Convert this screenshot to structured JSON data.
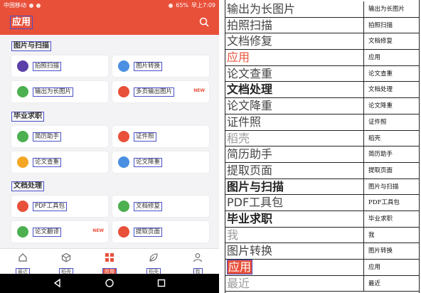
{
  "status_bar": {
    "carrier": "中国移动",
    "battery": "65%",
    "time": "早上7:09"
  },
  "app_bar": {
    "title": "应用"
  },
  "sections": [
    {
      "title": "图片与扫描",
      "items": [
        {
          "label": "拍照扫描",
          "icon_color": "#5b3fa8",
          "badge": ""
        },
        {
          "label": "图片转换",
          "icon_color": "#4a90e2",
          "badge": ""
        },
        {
          "label": "输出为长图片",
          "icon_color": "#4caf50",
          "badge": ""
        },
        {
          "label": "多页输出图片",
          "icon_color": "#e8503a",
          "badge": "NEW"
        }
      ]
    },
    {
      "title": "毕业求职",
      "items": [
        {
          "label": "简历助手",
          "icon_color": "#4caf50",
          "badge": ""
        },
        {
          "label": "证件照",
          "icon_color": "#e8503a",
          "badge": ""
        },
        {
          "label": "论文查重",
          "icon_color": "#f5a623",
          "badge": ""
        },
        {
          "label": "论文降重",
          "icon_color": "#4a90e2",
          "badge": ""
        }
      ]
    },
    {
      "title": "文档处理",
      "items": [
        {
          "label": "PDF工具包",
          "icon_color": "#e8503a",
          "badge": ""
        },
        {
          "label": "文档修复",
          "icon_color": "#4caf50",
          "badge": ""
        },
        {
          "label": "论文翻译",
          "icon_color": "#4caf50",
          "badge": "NEW"
        },
        {
          "label": "提取页面",
          "icon_color": "#e8503a",
          "badge": ""
        }
      ]
    }
  ],
  "tabs": [
    {
      "label": "最近",
      "icon": "home-icon"
    },
    {
      "label": "稻壳",
      "icon": "cube-icon"
    },
    {
      "label": "应用",
      "icon": "apps-grid-icon",
      "active": true
    },
    {
      "label": "稻壳",
      "icon": "leaf-icon"
    },
    {
      "label": "我",
      "icon": "person-icon"
    }
  ],
  "glossary": [
    {
      "zh": "输出为长图片",
      "en": "输出为长图片",
      "style": ""
    },
    {
      "zh": "拍照扫描",
      "en": "拍照扫描",
      "style": ""
    },
    {
      "zh": "文档修复",
      "en": "文档修复",
      "style": ""
    },
    {
      "zh": "应用",
      "en": "应用",
      "style": "red"
    },
    {
      "zh": "论文查重",
      "en": "论文查重",
      "style": ""
    },
    {
      "zh": "文档处理",
      "en": "文档处理",
      "style": "bold"
    },
    {
      "zh": "论文降重",
      "en": "论文降重",
      "style": ""
    },
    {
      "zh": "证件照",
      "en": "证件照",
      "style": ""
    },
    {
      "zh": "稻壳",
      "en": "稻壳",
      "style": "grey"
    },
    {
      "zh": "简历助手",
      "en": "简历助手",
      "style": ""
    },
    {
      "zh": "提取页面",
      "en": "提取页面",
      "style": ""
    },
    {
      "zh": "图片与扫描",
      "en": "图片与扫描",
      "style": "bold"
    },
    {
      "zh": "PDF工具包",
      "en": "PDF工具包",
      "style": ""
    },
    {
      "zh": "毕业求职",
      "en": "毕业求职",
      "style": "bold"
    },
    {
      "zh": "我",
      "en": "我",
      "style": "grey"
    },
    {
      "zh": "图片转换",
      "en": "图片转换",
      "style": ""
    },
    {
      "zh": "应用",
      "en": "应用",
      "style": "redbox"
    },
    {
      "zh": "最近",
      "en": "最近",
      "style": "grey"
    }
  ],
  "colors": {
    "accent": "#e8503a",
    "annotation_box": "#4a50c8"
  }
}
